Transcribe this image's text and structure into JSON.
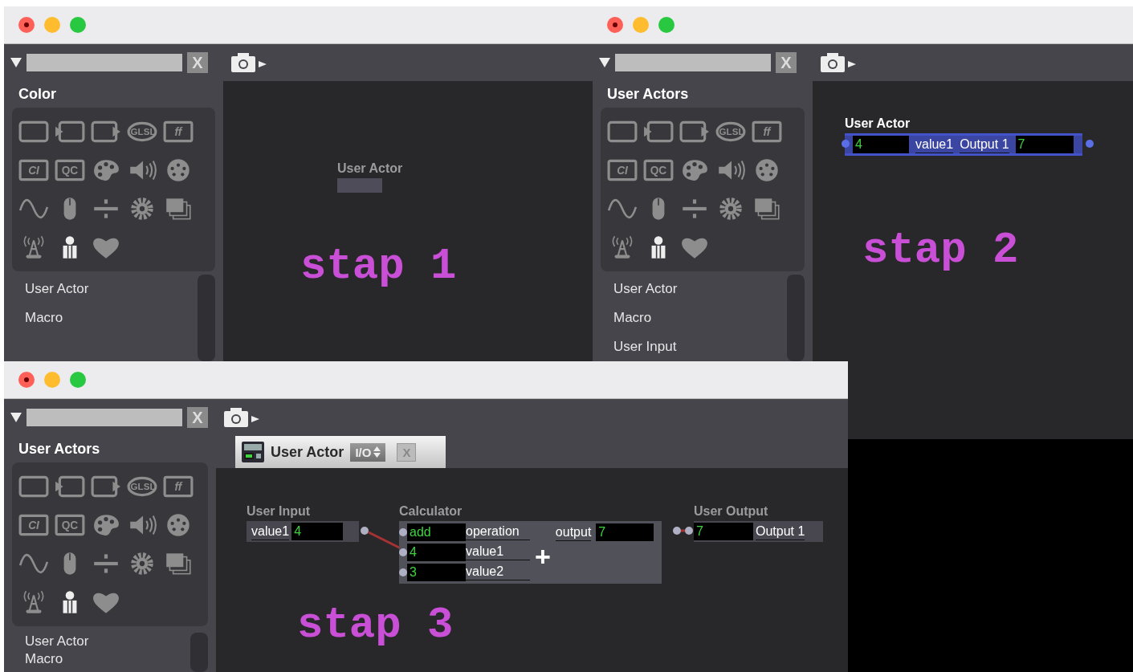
{
  "windows": [
    {
      "clear_button": "X",
      "sidebar": {
        "heading": "Color",
        "palette": [
          {
            "kind": "frame"
          },
          {
            "kind": "frame-in"
          },
          {
            "kind": "frame-out"
          },
          {
            "kind": "badge-oval",
            "label": "GLSL"
          },
          {
            "kind": "badge-italic",
            "label": "ff"
          },
          {
            "kind": "badge-italic",
            "label": "CI"
          },
          {
            "kind": "badge",
            "label": "QC"
          },
          {
            "kind": "palette"
          },
          {
            "kind": "speaker"
          },
          {
            "kind": "connector"
          },
          {
            "kind": "wave"
          },
          {
            "kind": "mouse"
          },
          {
            "kind": "divide"
          },
          {
            "kind": "gear"
          },
          {
            "kind": "stack"
          },
          {
            "kind": "antenna"
          },
          {
            "kind": "person"
          },
          {
            "kind": "heart"
          }
        ],
        "items": [
          "User Actor",
          "Macro"
        ]
      },
      "canvas": {
        "caption": "stap 1",
        "nodes": [
          {
            "kind": "empty",
            "title": "User Actor"
          }
        ]
      }
    },
    {
      "clear_button": "X",
      "sidebar": {
        "heading": "User Actors",
        "palette": [
          {
            "kind": "frame"
          },
          {
            "kind": "frame-in"
          },
          {
            "kind": "frame-out"
          },
          {
            "kind": "badge-oval",
            "label": "GLSL"
          },
          {
            "kind": "badge-italic",
            "label": "ff"
          },
          {
            "kind": "badge-italic",
            "label": "CI"
          },
          {
            "kind": "badge",
            "label": "QC"
          },
          {
            "kind": "palette"
          },
          {
            "kind": "speaker"
          },
          {
            "kind": "connector"
          },
          {
            "kind": "wave"
          },
          {
            "kind": "mouse"
          },
          {
            "kind": "divide"
          },
          {
            "kind": "gear"
          },
          {
            "kind": "stack"
          },
          {
            "kind": "antenna"
          },
          {
            "kind": "person"
          },
          {
            "kind": "heart"
          }
        ],
        "items": [
          "User Actor",
          "Macro",
          "User Input"
        ]
      },
      "canvas": {
        "caption": "stap 2",
        "nodes": [
          {
            "kind": "actor",
            "title": "User Actor",
            "selected": true,
            "input_value": "4",
            "input_label": "value1",
            "output_label": "Output 1",
            "output_value": "7"
          }
        ]
      }
    },
    {
      "clear_button": "X",
      "sidebar": {
        "heading": "User Actors",
        "palette": [
          {
            "kind": "frame"
          },
          {
            "kind": "frame-in"
          },
          {
            "kind": "frame-out"
          },
          {
            "kind": "badge-oval",
            "label": "GLSL"
          },
          {
            "kind": "badge-italic",
            "label": "ff"
          },
          {
            "kind": "badge-italic",
            "label": "CI"
          },
          {
            "kind": "badge",
            "label": "QC"
          },
          {
            "kind": "palette"
          },
          {
            "kind": "speaker"
          },
          {
            "kind": "connector"
          },
          {
            "kind": "wave"
          },
          {
            "kind": "mouse"
          },
          {
            "kind": "divide"
          },
          {
            "kind": "gear"
          },
          {
            "kind": "stack"
          },
          {
            "kind": "antenna"
          },
          {
            "kind": "person"
          },
          {
            "kind": "heart"
          }
        ],
        "items": [
          "User Actor",
          "Macro"
        ]
      },
      "canvas": {
        "caption": "stap 3",
        "tab": {
          "title": "User Actor",
          "mode": "I/O",
          "close": "X"
        },
        "nodes": [
          {
            "kind": "input",
            "title": "User Input",
            "input_label": "value1",
            "input_value": "4"
          },
          {
            "kind": "calculator",
            "title": "Calculator",
            "symbol": "+",
            "inputs": [
              {
                "value": "add",
                "label": "operation"
              },
              {
                "value": "4",
                "label": "value1"
              },
              {
                "value": "3",
                "label": "value2"
              }
            ],
            "output_label": "output",
            "output_value": "7"
          },
          {
            "kind": "output",
            "title": "User Output",
            "output_value": "7",
            "output_label": "Output 1"
          }
        ]
      }
    }
  ]
}
